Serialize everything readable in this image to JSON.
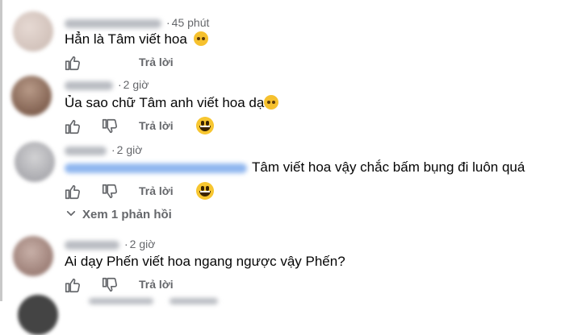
{
  "comments": [
    {
      "time": "45 phút",
      "text": "Hẳn là Tâm viết hoa",
      "emoji": "sad-face-emoji",
      "reply_label": "Trả lời",
      "reaction": "none"
    },
    {
      "time": "2 giờ",
      "text": "Ủa sao chữ Tâm anh viết hoa dạ",
      "emoji": "sad-face-emoji",
      "reply_label": "Trả lời",
      "reaction": "laugh-emoji"
    },
    {
      "time": "2 giờ",
      "text": "Tâm viết hoa vậy chắc bấm bụng đi luôn quá",
      "reply_label": "Trả lời",
      "reaction": "laugh-emoji",
      "view_replies": "Xem 1 phản hồi"
    },
    {
      "time": "2 giờ",
      "text": "Ai dạy Phến viết hoa ngang ngược vậy Phến?",
      "reply_label": "Trả lời",
      "reaction": "none"
    }
  ],
  "colors": {
    "text": "#050505",
    "secondary": "#65676b",
    "emoji": "#f7c630"
  },
  "icons": {
    "like": "thumbs-up-icon",
    "dislike": "thumbs-down-icon",
    "expand": "chevron-down-icon"
  }
}
